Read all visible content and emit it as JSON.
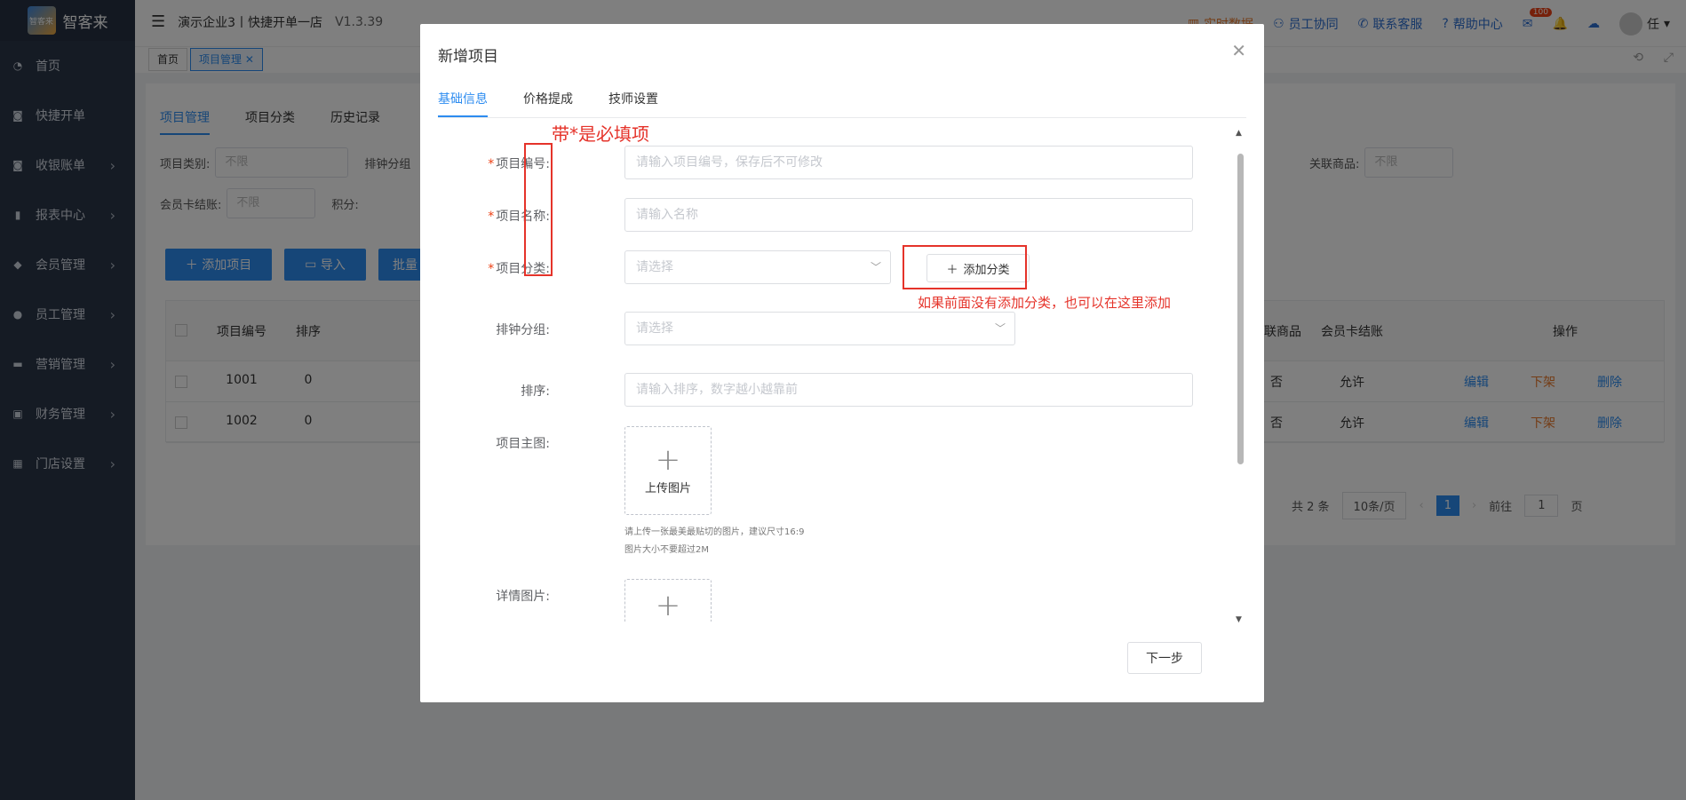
{
  "app": {
    "logo_text": "智客来",
    "logo_mark": "智客来",
    "store": "演示企业3丨快捷开单一店",
    "version": "V1.3.39"
  },
  "header": {
    "links": [
      "实时数据",
      "员工协同",
      "联系客服",
      "帮助中心"
    ],
    "badge": "100",
    "user": "任"
  },
  "sidebar": {
    "items": [
      {
        "label": "首页",
        "icon": "dashboard-icon"
      },
      {
        "label": "快捷开单",
        "icon": "bag-icon"
      },
      {
        "label": "收银账单",
        "icon": "cashier-icon"
      },
      {
        "label": "报表中心",
        "icon": "chart-icon"
      },
      {
        "label": "会员管理",
        "icon": "diamond-icon"
      },
      {
        "label": "员工管理",
        "icon": "user-icon"
      },
      {
        "label": "营销管理",
        "icon": "briefcase-icon"
      },
      {
        "label": "财务管理",
        "icon": "finance-icon"
      },
      {
        "label": "门店设置",
        "icon": "grid-icon"
      }
    ]
  },
  "tags": {
    "home": "首页",
    "current": "项目管理"
  },
  "page": {
    "tabs": [
      "项目管理",
      "项目分类",
      "历史记录"
    ],
    "filters": {
      "category_label": "项目类别:",
      "category_value": "不限",
      "group_label": "排钟分组",
      "related_label": "关联商品:",
      "related_value": "不限",
      "card_label": "会员卡结账:",
      "card_value": "不限",
      "points_label": "积分:"
    },
    "buttons": {
      "add": "添加项目",
      "import": "导入",
      "batch": "批量"
    },
    "table": {
      "headers": [
        "项目编号",
        "排序",
        "关联商品",
        "会员卡结账",
        "操作"
      ],
      "rows": [
        {
          "code": "1001",
          "sort": "0",
          "related": "否",
          "card": "允许"
        },
        {
          "code": "1002",
          "sort": "0",
          "related": "否",
          "card": "允许"
        }
      ],
      "actions": [
        "编辑",
        "下架",
        "删除"
      ]
    },
    "pagination": {
      "total": "共 2 条",
      "page_size": "10条/页",
      "current": "1",
      "goto_label": "前往",
      "goto_value": "1",
      "goto_suffix": "页"
    }
  },
  "modal": {
    "title": "新增项目",
    "tabs": [
      "基础信息",
      "价格提成",
      "技师设置"
    ],
    "fields": {
      "code_label": "项目编号:",
      "code_placeholder": "请输入项目编号，保存后不可修改",
      "name_label": "项目名称:",
      "name_placeholder": "请输入名称",
      "category_label": "项目分类:",
      "category_placeholder": "请选择",
      "add_category": "添加分类",
      "group_label": "排钟分组:",
      "group_placeholder": "请选择",
      "sort_label": "排序:",
      "sort_placeholder": "请输入排序，数字越小越靠前",
      "main_image_label": "项目主图:",
      "upload_text": "上传图片",
      "hint_line1": "请上传一张最美最贴切的图片，建议尺寸16:9",
      "hint_line2": "图片大小不要超过2M",
      "detail_image_label": "详情图片:"
    },
    "next": "下一步",
    "required_mark": "*"
  },
  "annotations": {
    "required_note": "带*是必填项",
    "category_note": "如果前面没有添加分类，也可以在这里添加"
  },
  "colors": {
    "primary": "#2d8cf0",
    "sidebar": "#2b3649",
    "annotation": "#e5332a"
  }
}
